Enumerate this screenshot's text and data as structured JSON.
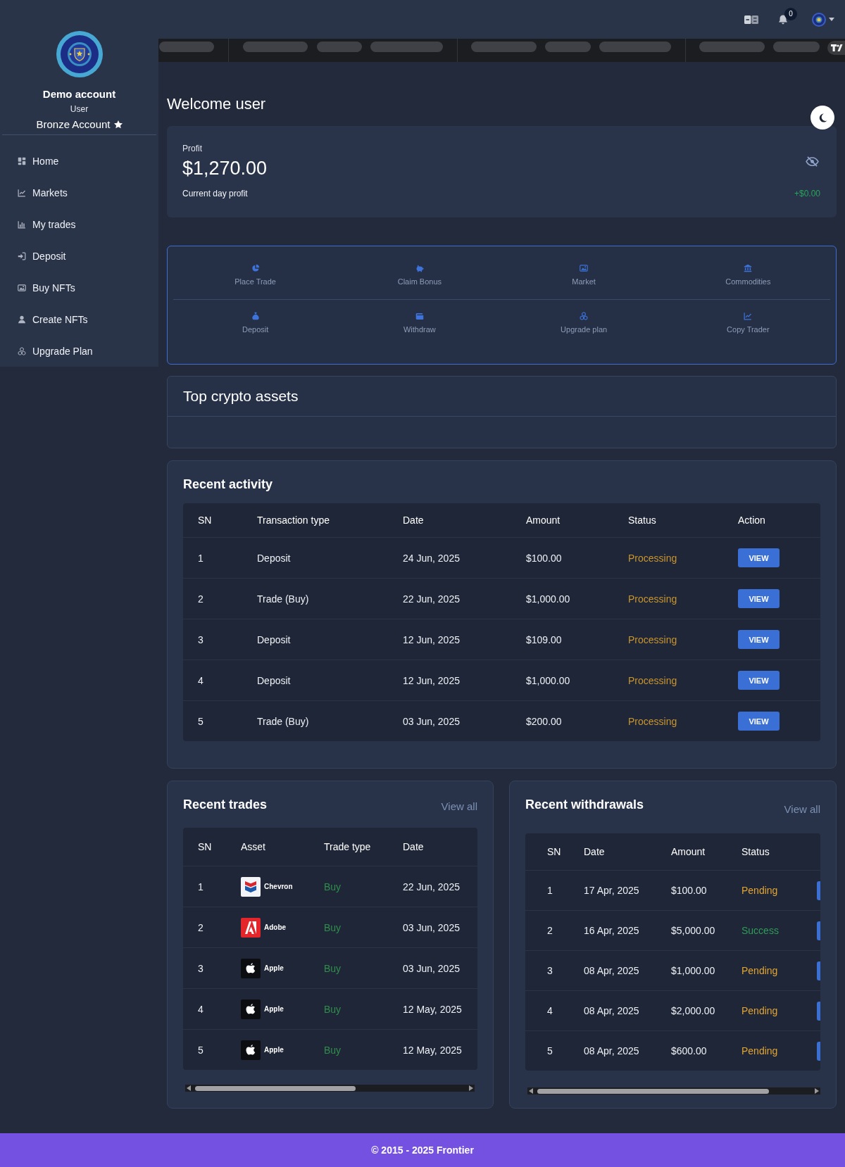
{
  "topbar": {
    "notification_count": "0"
  },
  "ticker": {
    "loading": true
  },
  "sidebar": {
    "profile": {
      "name": "Demo account",
      "role": "User",
      "plan": "Bronze Account"
    },
    "items": [
      {
        "label": "Home",
        "selected": false
      },
      {
        "label": "Markets",
        "selected": false
      },
      {
        "label": "My trades",
        "selected": false
      },
      {
        "label": "Deposit",
        "selected": false
      },
      {
        "label": "Buy NFTs",
        "selected": false
      },
      {
        "label": "Create NFTs",
        "selected": false
      },
      {
        "label": "Upgrade Plan",
        "selected": false
      }
    ]
  },
  "welcome": {
    "title": "Welcome user"
  },
  "profit_card": {
    "label": "Profit",
    "amount": "$1,270.00",
    "caption": "Current day profit",
    "change": "+$0.00"
  },
  "quick_actions": {
    "rows": [
      {
        "items": [
          {
            "label": "Place Trade"
          },
          {
            "label": "Claim Bonus"
          },
          {
            "label": "Market"
          },
          {
            "label": "Commodities"
          }
        ]
      },
      {
        "items": [
          {
            "label": "Deposit"
          },
          {
            "label": "Withdraw"
          },
          {
            "label": "Upgrade plan"
          },
          {
            "label": "Copy Trader"
          }
        ]
      }
    ]
  },
  "top_crypto_assets": {
    "title": "Top crypto assets"
  },
  "recent_activity": {
    "title": "Recent activity",
    "columns": [
      "SN",
      "Transaction type",
      "Date",
      "Amount",
      "Status",
      "Action"
    ],
    "rows": [
      {
        "sn": "1",
        "type": "Deposit",
        "date": "24 Jun, 2025",
        "amount": "$100.00",
        "status": "Processing",
        "action": "VIEW"
      },
      {
        "sn": "2",
        "type": "Trade (Buy)",
        "date": "22 Jun, 2025",
        "amount": "$1,000.00",
        "status": "Processing",
        "action": "VIEW"
      },
      {
        "sn": "3",
        "type": "Deposit",
        "date": "12 Jun, 2025",
        "amount": "$109.00",
        "status": "Processing",
        "action": "VIEW"
      },
      {
        "sn": "4",
        "type": "Deposit",
        "date": "12 Jun, 2025",
        "amount": "$1,000.00",
        "status": "Processing",
        "action": "VIEW"
      },
      {
        "sn": "5",
        "type": "Trade (Buy)",
        "date": "03 Jun, 2025",
        "amount": "$200.00",
        "status": "Processing",
        "action": "VIEW"
      }
    ]
  },
  "recent_trades": {
    "title": "Recent trades",
    "link": "View all",
    "columns": [
      "SN",
      "Asset",
      "Trade type",
      "Date"
    ],
    "rows": [
      {
        "sn": "1",
        "asset": {
          "name": "Chevron",
          "kind": "chevron"
        },
        "trade_type": "Buy",
        "date": "22 Jun, 2025"
      },
      {
        "sn": "2",
        "asset": {
          "name": "Adobe",
          "kind": "adobe"
        },
        "trade_type": "Buy",
        "date": "03 Jun, 2025"
      },
      {
        "sn": "3",
        "asset": {
          "name": "Apple",
          "kind": "apple"
        },
        "trade_type": "Buy",
        "date": "03 Jun, 2025"
      },
      {
        "sn": "4",
        "asset": {
          "name": "Apple",
          "kind": "apple"
        },
        "trade_type": "Buy",
        "date": "12 May, 2025"
      },
      {
        "sn": "5",
        "asset": {
          "name": "Apple",
          "kind": "apple"
        },
        "trade_type": "Buy",
        "date": "12 May, 2025"
      }
    ]
  },
  "recent_withdrawals": {
    "title": "Recent withdrawals",
    "link": "View all",
    "columns": [
      "SN",
      "Date",
      "Amount",
      "Status"
    ],
    "clipped_action_column": true,
    "rows": [
      {
        "sn": "1",
        "date": "17 Apr, 2025",
        "amount": "$100.00",
        "status": {
          "text": "Pending",
          "color": "#e2a531"
        }
      },
      {
        "sn": "2",
        "date": "16 Apr, 2025",
        "amount": "$5,000.00",
        "status": {
          "text": "Success",
          "color": "#2e9d57"
        }
      },
      {
        "sn": "3",
        "date": "08 Apr, 2025",
        "amount": "$1,000.00",
        "status": {
          "text": "Pending",
          "color": "#e2a531"
        }
      },
      {
        "sn": "4",
        "date": "08 Apr, 2025",
        "amount": "$2,000.00",
        "status": {
          "text": "Pending",
          "color": "#e2a531"
        }
      },
      {
        "sn": "5",
        "date": "08 Apr, 2025",
        "amount": "$600.00",
        "status": {
          "text": "Pending",
          "color": "#e2a531"
        }
      }
    ]
  },
  "footer": {
    "text": "© 2015 - 2025 Frontier"
  }
}
